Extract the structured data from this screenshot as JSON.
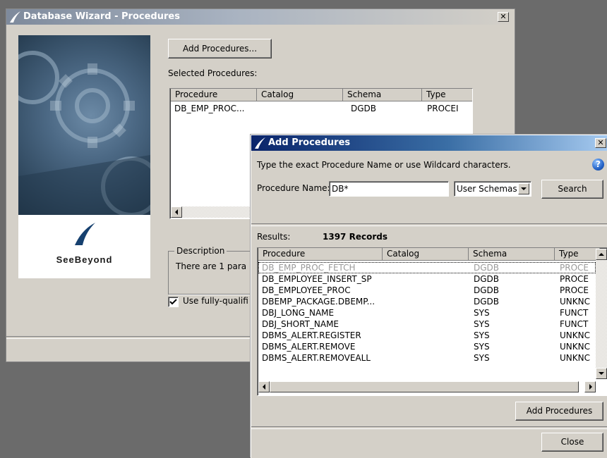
{
  "wizard": {
    "title": "Database Wizard - Procedures",
    "add_button": "Add Procedures...",
    "selected_label": "Selected Procedures:",
    "columns": [
      "Procedure",
      "Catalog",
      "Schema",
      "Type"
    ],
    "rows": [
      {
        "procedure": "DB_EMP_PROC...",
        "catalog": "",
        "schema": "DGDB",
        "type": "PROCEI"
      }
    ],
    "brand_text": "SeeBeyond",
    "description_label": "Description",
    "description_text": "There are 1 para",
    "checkbox_label": "Use fully-qualifi",
    "checkbox_checked": true
  },
  "dialog": {
    "title": "Add Procedures",
    "instructions": "Type the exact Procedure Name or use Wildcard characters.",
    "name_label": "Procedure Name:",
    "name_value": "DB*",
    "schema_select": "User Schemas",
    "search_button": "Search",
    "results_label": "Results:",
    "results_count": "1397 Records",
    "columns": [
      "Procedure",
      "Catalog",
      "Schema",
      "Type"
    ],
    "rows": [
      {
        "procedure": "DB_EMP_PROC_FETCH",
        "catalog": "",
        "schema": "DGDB",
        "type": "PROCE",
        "disabled": true
      },
      {
        "procedure": "DB_EMPLOYEE_INSERT_SP",
        "catalog": "",
        "schema": "DGDB",
        "type": "PROCE"
      },
      {
        "procedure": "DB_EMPLOYEE_PROC",
        "catalog": "",
        "schema": "DGDB",
        "type": "PROCE"
      },
      {
        "procedure": "DBEMP_PACKAGE.DBEMP...",
        "catalog": "",
        "schema": "DGDB",
        "type": "UNKNC"
      },
      {
        "procedure": "DBJ_LONG_NAME",
        "catalog": "",
        "schema": "SYS",
        "type": "FUNCT"
      },
      {
        "procedure": "DBJ_SHORT_NAME",
        "catalog": "",
        "schema": "SYS",
        "type": "FUNCT"
      },
      {
        "procedure": "DBMS_ALERT.REGISTER",
        "catalog": "",
        "schema": "SYS",
        "type": "UNKNC"
      },
      {
        "procedure": "DBMS_ALERT.REMOVE",
        "catalog": "",
        "schema": "SYS",
        "type": "UNKNC"
      },
      {
        "procedure": "DBMS_ALERT.REMOVEALL",
        "catalog": "",
        "schema": "SYS",
        "type": "UNKNC"
      }
    ],
    "add_button": "Add Procedures",
    "close_button": "Close"
  },
  "colors": {
    "window_bg": "#d4d0c8",
    "dialog_title": "#0a246a",
    "wizard_title": "#7e8a9c",
    "desktop": "#6b6b6b"
  },
  "icons": [
    "seebeyond-logo-icon",
    "close-icon",
    "help-icon",
    "chevron-down-icon"
  ]
}
